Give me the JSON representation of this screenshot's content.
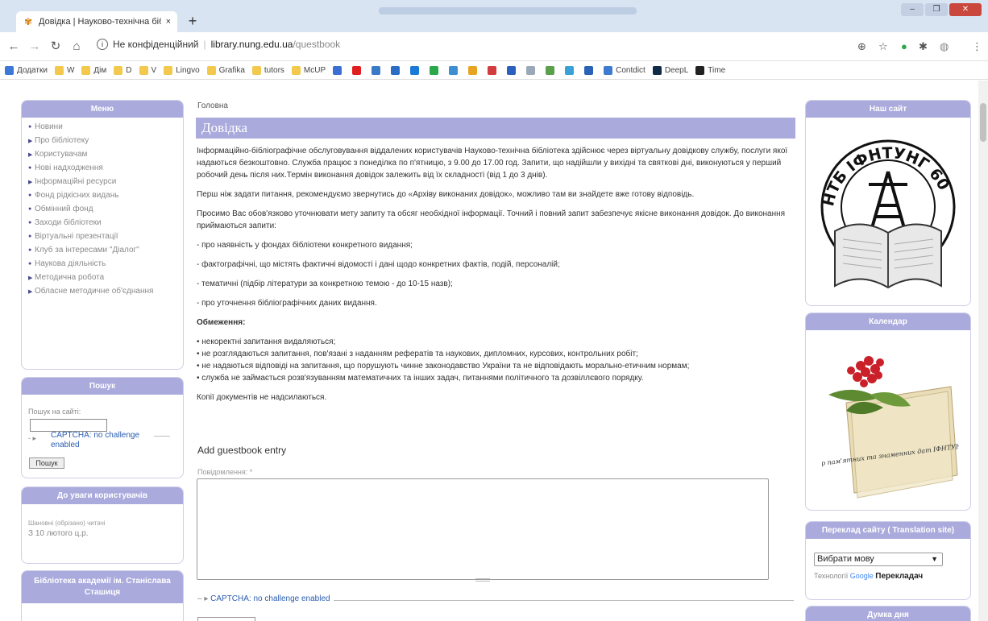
{
  "browser": {
    "tab_title": "Довідка | Науково-технічна бібл",
    "tab_close": "×",
    "new_tab": "+",
    "url_security": "Не конфіденційний",
    "url_host": "library.nung.edu.ua",
    "url_path": "/questbook"
  },
  "bookmarks": [
    {
      "label": "Додатки",
      "icon": "apps-icon",
      "color": "#3c78d8"
    },
    {
      "label": "W",
      "icon": "folder-icon",
      "color": "#f2c94c"
    },
    {
      "label": "Дім",
      "icon": "folder-icon",
      "color": "#f2c94c"
    },
    {
      "label": "D",
      "icon": "folder-icon",
      "color": "#f2c94c"
    },
    {
      "label": "V",
      "icon": "folder-icon",
      "color": "#f2c94c"
    },
    {
      "label": "Lingvo",
      "icon": "folder-icon",
      "color": "#f2c94c"
    },
    {
      "label": "Grafika",
      "icon": "folder-icon",
      "color": "#f2c94c"
    },
    {
      "label": "tutors",
      "icon": "folder-icon",
      "color": "#f2c94c"
    },
    {
      "label": "McUP",
      "icon": "folder-icon",
      "color": "#f2c94c"
    },
    {
      "label": "",
      "icon": "blue-square-icon",
      "color": "#3b6fd4"
    },
    {
      "label": "",
      "icon": "youtube-icon",
      "color": "#e02020"
    },
    {
      "label": "",
      "icon": "site-icon",
      "color": "#3a7bc8"
    },
    {
      "label": "",
      "icon": "site-icon",
      "color": "#2b6cc4"
    },
    {
      "label": "",
      "icon": "site-icon",
      "color": "#1a7ad6"
    },
    {
      "label": "",
      "icon": "site-icon",
      "color": "#2aa84a"
    },
    {
      "label": "",
      "icon": "site-icon",
      "color": "#3d8fd1"
    },
    {
      "label": "",
      "icon": "site-icon",
      "color": "#e8a320"
    },
    {
      "label": "",
      "icon": "site-icon",
      "color": "#d23c3c"
    },
    {
      "label": "",
      "icon": "site-icon",
      "color": "#2b5fc0"
    },
    {
      "label": "",
      "icon": "site-icon",
      "color": "#9aa8b8"
    },
    {
      "label": "",
      "icon": "site-icon",
      "color": "#5aa04a"
    },
    {
      "label": "",
      "icon": "site-icon",
      "color": "#3aa0d8"
    },
    {
      "label": "",
      "icon": "site-icon",
      "color": "#2a62b8"
    },
    {
      "label": "Contdict",
      "icon": "site-icon",
      "color": "#3d7bd0"
    },
    {
      "label": "DeepL",
      "icon": "site-icon",
      "color": "#0f2b46"
    },
    {
      "label": "Time",
      "icon": "site-icon",
      "color": "#222222"
    }
  ],
  "left": {
    "menu_title": "Меню",
    "menu": [
      {
        "label": "Новини",
        "marker": "●"
      },
      {
        "label": "Про бібліотеку",
        "marker": "▶"
      },
      {
        "label": "Користувачам",
        "marker": "▶"
      },
      {
        "label": "Нові надходження",
        "marker": "●"
      },
      {
        "label": "Інформаційні ресурси",
        "marker": "▶"
      },
      {
        "label": "Фонд рідкісних видань",
        "marker": "●"
      },
      {
        "label": "Обмінний фонд",
        "marker": "●"
      },
      {
        "label": "Заходи бібліотеки",
        "marker": "●"
      },
      {
        "label": "Віртуальні презентації",
        "marker": "●"
      },
      {
        "label": "Клуб за інтересами \"Діалог\"",
        "marker": "●"
      },
      {
        "label": "Наукова діяльність",
        "marker": "●"
      },
      {
        "label": "Методична робота",
        "marker": "▶"
      },
      {
        "label": "Обласне методичне об'єднання",
        "marker": "▶"
      }
    ],
    "search_title": "Пошук",
    "search_label": "Пошук на сайті:",
    "captcha": "CAPTCHA: no challenge enabled",
    "search_button": "Пошук",
    "notice_title": "До уваги користувачів",
    "notice_line1": "Шановні (обрізано) читачі",
    "notice_line2": "З 10 лютого ц.р.",
    "library_title": "Бібліотека академії ім. Станіслава Сташиця"
  },
  "main": {
    "breadcrumb": "Головна",
    "title": "Довідка",
    "p1": "Інформаційно-бібліографічне обслуговування віддалених користувачів Науково-технічна бібліотека здійснює через віртуальну довідкову службу, послуги якої надаються безкоштовно. Служба працює з понеділка по п'ятницю, з 9.00 до 17.00 год. Запити, що надійшли у вихідні та святкові дні, виконуються у перший робочий день після них.Термін виконання довідок залежить від їх складності (від 1 до 3 днів).",
    "p2": "Перш ніж задати питання, рекомендуємо звернутись до «Архіву виконаних довідок», можливо там ви знайдете вже готову відповідь.",
    "p3": "Просимо Вас обов'язково уточнювати мету запиту та обсяг необхідної інформації. Точний і повний запит забезпечує якісне виконання довідок. До виконання приймаються запити:",
    "items": [
      "- про наявність у фондах бібліотеки конкретного видання;",
      "- фактографічні, що містять фактичні відомості і дані щодо конкретних фактів, подій, персоналій;",
      "- тематичні (підбір літератури за конкретною темою - до 10-15 назв);",
      "- про уточнення бібліографічних даних видання."
    ],
    "limits_title": "Обмеження:",
    "limits": [
      "• некоректні запитання видаляються;",
      "• не розглядаються запитання, пов'язані з наданням рефератів та наукових, дипломних, курсових, контрольних робіт;",
      "• не надаються відповіді на запитання, що порушують чинне законодавство України та не відповідають морально-етичним нормам;",
      "• служба не займається розв'язуванням математичних та інших задач, питаннями політичного та дозвіллєвого порядку."
    ],
    "copies": "Копії документів не надсилаються.",
    "add_entry": "Add guestbook entry",
    "message_label": "Повідомлення: *",
    "captcha": "CAPTCHA: no challenge enabled"
  },
  "right": {
    "our_site_title": "Наш сайт",
    "logo_text": "НТБ ІФНТУНГ 60 років",
    "calendar_title": "Календар",
    "calendar_text": "Календар пам'ятних та знаменних дат ІФНТУНГ на 2021 рік",
    "translate_title": "Переклад сайту ( Translation site)",
    "select_label": "Вибрати мову",
    "powered": "Технології",
    "google": "Google",
    "translator": "Перекладач",
    "thought_title": "Думка дня"
  },
  "colors": {
    "panel_header": "#aaaadd",
    "link": "#2a5db0"
  }
}
